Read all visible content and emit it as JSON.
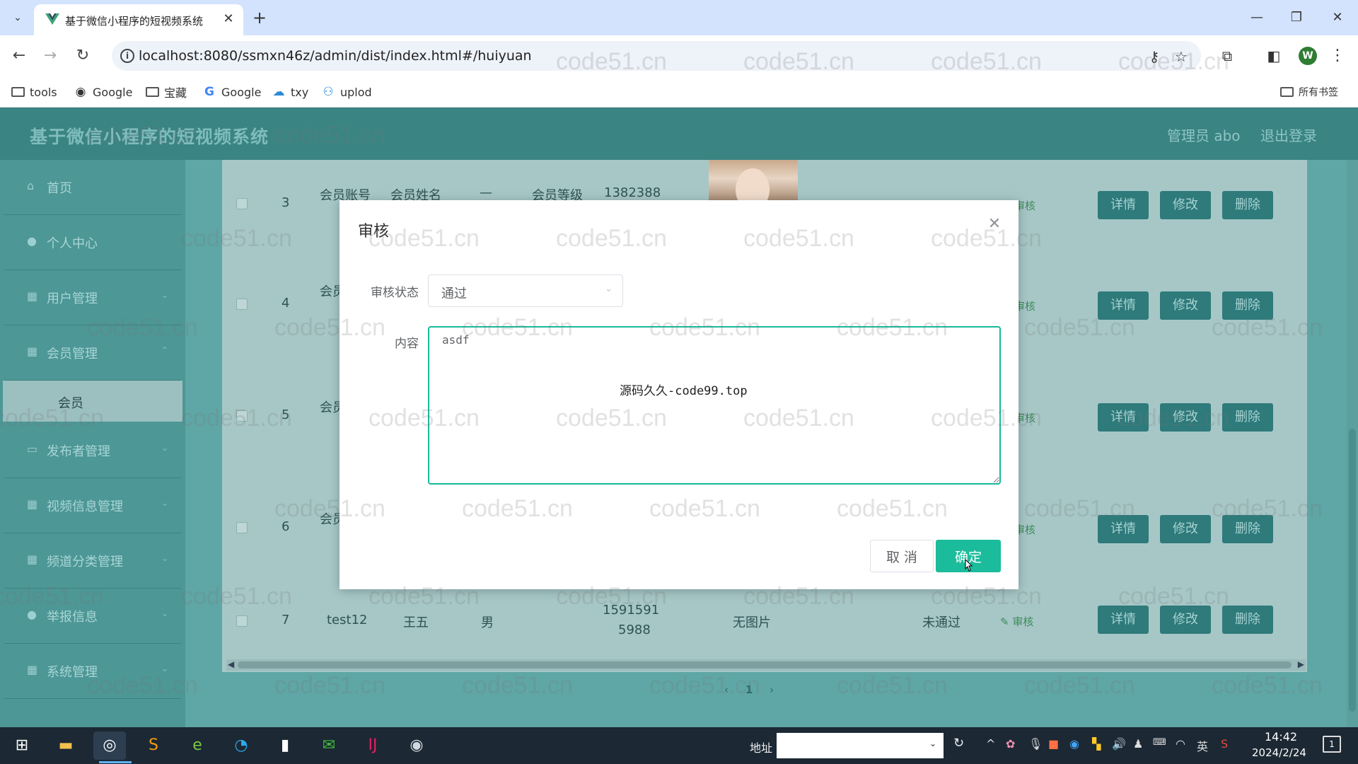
{
  "browser": {
    "tab_title": "基于微信小程序的短视频系统",
    "url": "localhost:8080/ssmxn46z/admin/dist/index.html#/huiyuan",
    "bookmarks": [
      "tools",
      "Google",
      "宝藏",
      "Google",
      "txy",
      "uplod"
    ],
    "all_bookmarks": "所有书签",
    "profile_initial": "W"
  },
  "app": {
    "title": "基于微信小程序的短视频系统",
    "admin_label": "管理员 abo",
    "logout": "退出登录"
  },
  "sidebar": {
    "items": [
      {
        "label": "首页",
        "icon": "home-icon"
      },
      {
        "label": "个人中心",
        "icon": "person-icon"
      },
      {
        "label": "用户管理",
        "icon": "grid-icon"
      },
      {
        "label": "会员管理",
        "icon": "grid-icon"
      },
      {
        "label": "会员",
        "sub": true
      },
      {
        "label": "发布者管理",
        "icon": "monitor-icon"
      },
      {
        "label": "视频信息管理",
        "icon": "grid-icon"
      },
      {
        "label": "频道分类管理",
        "icon": "grid-icon"
      },
      {
        "label": "举报信息",
        "icon": "person-icon"
      },
      {
        "label": "系统管理",
        "icon": "grid-icon"
      }
    ]
  },
  "table": {
    "header_cells": [
      "会员账号",
      "会员姓名",
      "—",
      "会员等级",
      "1382388"
    ],
    "rows": [
      {
        "index": "3",
        "prefix": "",
        "status": "",
        "audit": "审核"
      },
      {
        "index": "4",
        "prefix": "会员",
        "status": "",
        "audit": "审核"
      },
      {
        "index": "5",
        "prefix": "会员",
        "status": "",
        "audit": "审核"
      },
      {
        "index": "6",
        "prefix": "会员",
        "status": "",
        "audit": "审核"
      },
      {
        "index": "7",
        "account": "test12",
        "name": "王五",
        "gender": "男",
        "phone_line1": "1591591",
        "phone_line2": "5988",
        "image": "无图片",
        "status": "未通过",
        "audit": "审核"
      }
    ],
    "actions": {
      "detail": "详情",
      "edit": "修改",
      "delete": "删除"
    },
    "page": "1"
  },
  "modal": {
    "title": "审核",
    "status_label": "审核状态",
    "status_value": "通过",
    "content_label": "内容",
    "content_value": "asdf",
    "cancel": "取 消",
    "confirm": "确定"
  },
  "overlay_text": "源码久久-code99.top",
  "watermark": "code51.cn",
  "taskbar": {
    "address_label": "地址",
    "ime": "英",
    "time": "14:42",
    "date": "2024/2/24",
    "notification_count": "1"
  }
}
